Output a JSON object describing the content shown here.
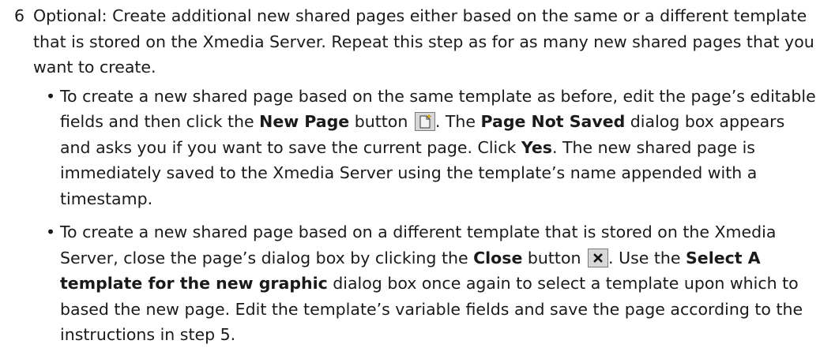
{
  "step": {
    "number": "6",
    "text": "Optional: Create additional new shared pages either based on the same or a different template that is stored on the Xmedia Server. Repeat this step as for as many new shared pages that you want to create."
  },
  "bullets": [
    {
      "marker": "•",
      "t1": "To create a new shared page based on the same template as before, edit the page’s editable fields and then click the ",
      "b1": "New Page",
      "t2": " button ",
      "icon": "new-page-icon",
      "t3": ". The ",
      "b2": "Page Not Saved",
      "t4": " dialog box appears and asks you if you want to save the current page. Click ",
      "b3": "Yes",
      "t5": ". The new shared page is immediately saved to the Xmedia Server using the template’s name appended with a timestamp."
    },
    {
      "marker": "•",
      "t1": "To create a new shared page based on a different template that is stored on the Xmedia Server, close the page’s dialog box by clicking the ",
      "b1": "Close",
      "t2": " button ",
      "icon": "close-icon",
      "t3": ". Use the ",
      "b2": "Select A template for the new graphic",
      "t4": " dialog box once again to select a template upon which to based the new page. Edit the template’s variable fields and save the page according to the instructions in step 5."
    }
  ]
}
